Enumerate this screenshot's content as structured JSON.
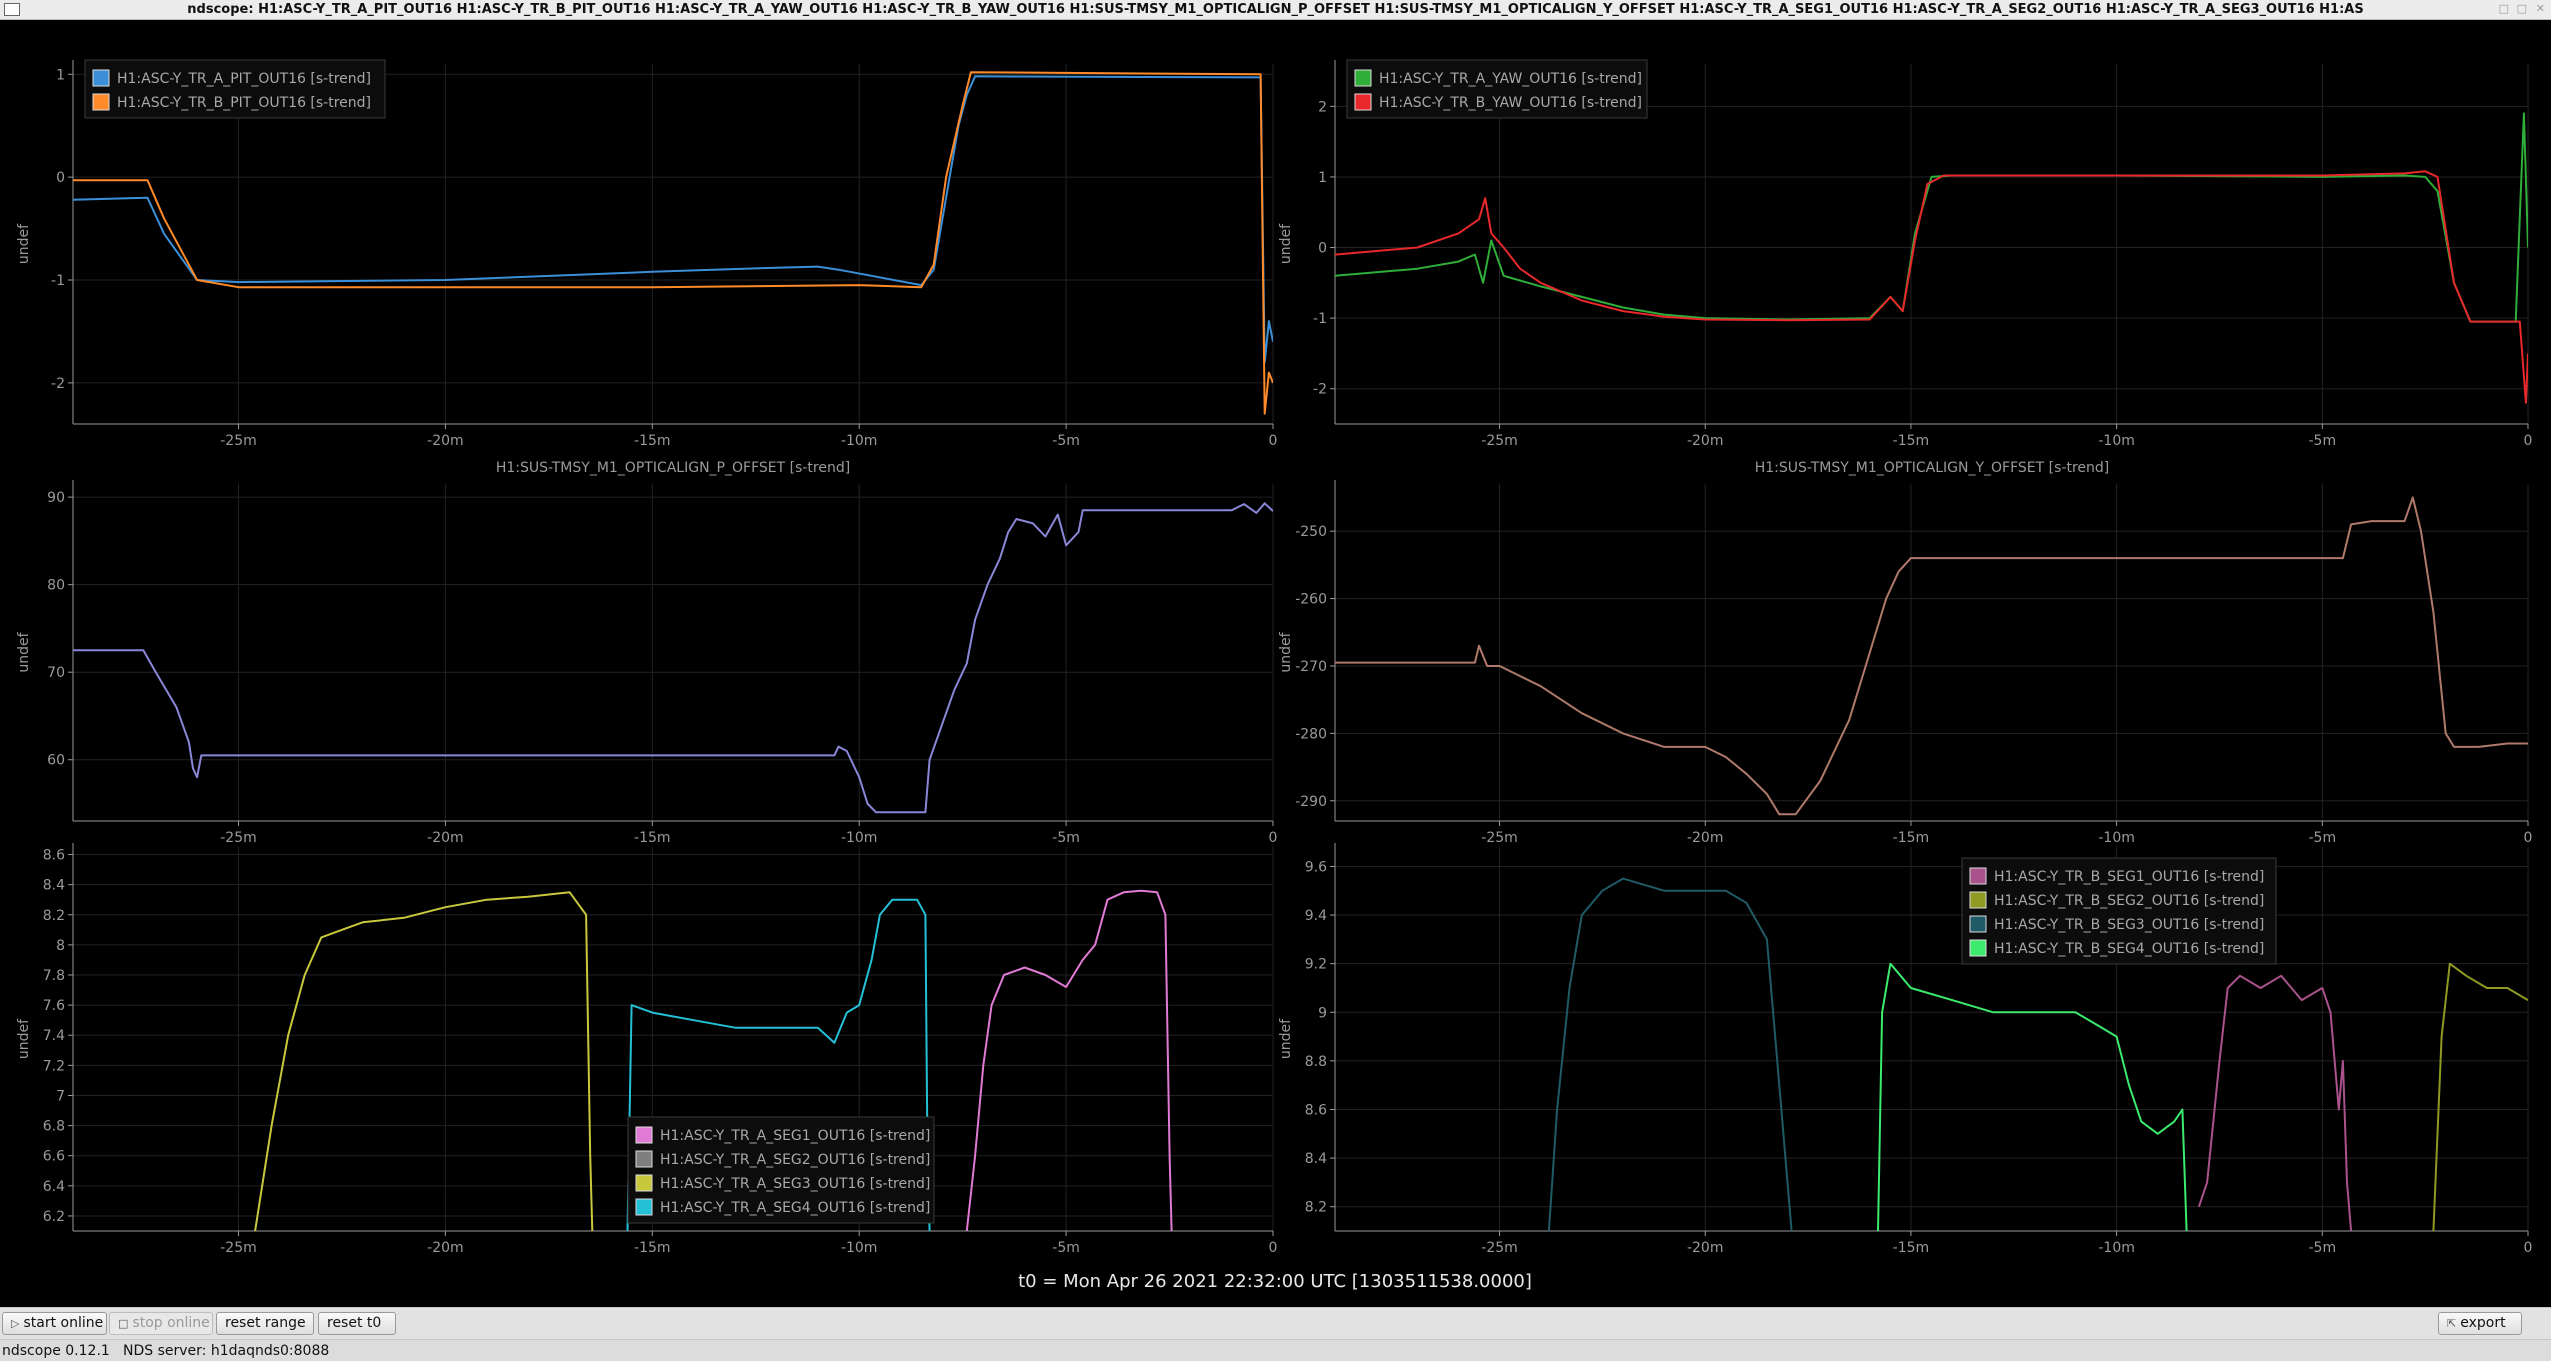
{
  "window": {
    "title": "ndscope: H1:ASC-Y_TR_A_PIT_OUT16 H1:ASC-Y_TR_B_PIT_OUT16 H1:ASC-Y_TR_A_YAW_OUT16 H1:ASC-Y_TR_B_YAW_OUT16 H1:SUS-TMSY_M1_OPTICALIGN_P_OFFSET H1:SUS-TMSY_M1_OPTICALIGN_Y_OFFSET H1:ASC-Y_TR_A_SEG1_OUT16 H1:ASC-Y_TR_A_SEG2_OUT16 H1:ASC-Y_TR_A_SEG3_OUT16 H1:AS"
  },
  "colors": {
    "background": "#000000",
    "axis": "#9a9a9a",
    "grid": "#222222",
    "blue": "#3a8fd8",
    "orange": "#ff8a2a",
    "green": "#2fae3a",
    "red": "#e8282b",
    "purple": "#8a86d8",
    "brown": "#b07a6a",
    "pink": "#e07ad4",
    "gray": "#7f7f7f",
    "yellow": "#c8c83c",
    "cyan": "#24c0d6",
    "mauve": "#a9528c",
    "olive": "#8f9a22",
    "teal": "#1f5a66",
    "lime": "#3cea6e"
  },
  "x_axis": {
    "ticks": [
      -25,
      -20,
      -15,
      -10,
      -5,
      0
    ],
    "tick_labels": [
      "-25m",
      "-20m",
      "-15m",
      "-10m",
      "-5m",
      "0"
    ],
    "xlim": [
      -29,
      0
    ]
  },
  "t0_label": "t0 = Mon Apr 26 2021 22:32:00 UTC [1303511538.0000]",
  "toolbar": {
    "start_online": "start online",
    "stop_online": "stop online",
    "reset_range": "reset range",
    "reset_t0": "reset t0",
    "export": "export"
  },
  "status": {
    "version": "ndscope 0.12.1",
    "server": "NDS server: h1daqnds0:8088"
  },
  "chart_data": [
    {
      "type": "line",
      "ylabel": "undef",
      "ylim": [
        -2.4,
        1.1
      ],
      "yticks": [
        -2,
        -1,
        0,
        1
      ],
      "ytick_labels": [
        "-2",
        "-1",
        "0",
        "1"
      ],
      "grid": true,
      "legend_position": "top-left",
      "series": [
        {
          "name": "H1:ASC-Y_TR_A_PIT_OUT16 [s-trend]",
          "color": "#3a8fd8",
          "x": [
            -29,
            -27.2,
            -26.8,
            -26,
            -25,
            -20,
            -15,
            -12,
            -11,
            -10.5,
            -8.5,
            -8.2,
            -7.6,
            -7.4,
            -7.2,
            -0.3,
            -0.2,
            -0.1,
            0
          ],
          "y": [
            -0.22,
            -0.2,
            -0.55,
            -1.0,
            -1.02,
            -1.0,
            -0.92,
            -0.88,
            -0.87,
            -0.9,
            -1.05,
            -0.9,
            0.5,
            0.8,
            0.98,
            0.97,
            -1.8,
            -1.4,
            -1.6
          ]
        },
        {
          "name": "H1:ASC-Y_TR_B_PIT_OUT16 [s-trend]",
          "color": "#ff8a2a",
          "x": [
            -29,
            -27.2,
            -26.8,
            -26,
            -25,
            -20,
            -15,
            -10,
            -8.5,
            -8.2,
            -7.9,
            -7.5,
            -7.3,
            -0.3,
            -0.2,
            -0.1,
            0
          ],
          "y": [
            -0.03,
            -0.03,
            -0.4,
            -1.0,
            -1.07,
            -1.07,
            -1.07,
            -1.05,
            -1.07,
            -0.85,
            0.0,
            0.7,
            1.02,
            1.0,
            -2.3,
            -1.9,
            -2.0
          ]
        }
      ]
    },
    {
      "type": "line",
      "ylabel": "undef",
      "ylim": [
        -2.5,
        2.6
      ],
      "yticks": [
        -2,
        -1,
        0,
        1,
        2
      ],
      "ytick_labels": [
        "-2",
        "-1",
        "0",
        "1",
        "2"
      ],
      "grid": true,
      "legend_position": "top-left",
      "series": [
        {
          "name": "H1:ASC-Y_TR_A_YAW_OUT16 [s-trend]",
          "color": "#2fae3a",
          "x": [
            -29,
            -27,
            -26,
            -25.6,
            -25.4,
            -25.2,
            -24.9,
            -24,
            -23,
            -22,
            -21,
            -20,
            -18,
            -16,
            -15.5,
            -15.2,
            -14.9,
            -14.5,
            -14,
            -10,
            -5,
            -3,
            -2.5,
            -2.2,
            -1.8,
            -1.4,
            -0.6,
            -0.3,
            -0.1,
            0
          ],
          "y": [
            -0.4,
            -0.3,
            -0.2,
            -0.1,
            -0.5,
            0.1,
            -0.4,
            -0.55,
            -0.7,
            -0.85,
            -0.95,
            -1.0,
            -1.02,
            -1.0,
            -0.7,
            -0.9,
            0.2,
            1.0,
            1.02,
            1.02,
            1.0,
            1.02,
            1.0,
            0.8,
            -0.5,
            -1.05,
            -1.05,
            -1.05,
            1.9,
            0.0
          ]
        },
        {
          "name": "H1:ASC-Y_TR_B_YAW_OUT16 [s-trend]",
          "color": "#e8282b",
          "x": [
            -29,
            -27,
            -26,
            -25.5,
            -25.35,
            -25.2,
            -24.9,
            -24.5,
            -24,
            -23,
            -22,
            -21,
            -20,
            -18,
            -16,
            -15.5,
            -15.2,
            -14.9,
            -14.6,
            -14.2,
            -10,
            -5,
            -3,
            -2.5,
            -2.2,
            -1.8,
            -1.4,
            -0.6,
            -0.2,
            -0.05,
            0
          ],
          "y": [
            -0.1,
            0.0,
            0.2,
            0.4,
            0.7,
            0.2,
            0.0,
            -0.3,
            -0.5,
            -0.75,
            -0.9,
            -0.98,
            -1.02,
            -1.03,
            -1.02,
            -0.7,
            -0.9,
            0.1,
            0.9,
            1.02,
            1.02,
            1.02,
            1.05,
            1.08,
            1.0,
            -0.5,
            -1.05,
            -1.05,
            -1.05,
            -2.2,
            -1.5
          ]
        }
      ]
    },
    {
      "type": "line",
      "title": "H1:SUS-TMSY_M1_OPTICALIGN_P_OFFSET [s-trend]",
      "ylabel": "undef",
      "ylim": [
        53,
        91.5
      ],
      "yticks": [
        60,
        70,
        80,
        90
      ],
      "ytick_labels": [
        "60",
        "70",
        "80",
        "90"
      ],
      "grid": true,
      "series": [
        {
          "name": "H1:SUS-TMSY_M1_OPTICALIGN_P_OFFSET [s-trend]",
          "color": "#8a86d8",
          "x": [
            -29,
            -27.3,
            -27,
            -26.5,
            -26.2,
            -26.1,
            -26,
            -25.9,
            -25,
            -20,
            -15,
            -10.6,
            -10.5,
            -10.3,
            -10,
            -9.8,
            -9.6,
            -9.5,
            -8.4,
            -8.3,
            -8.0,
            -7.7,
            -7.4,
            -7.2,
            -6.9,
            -6.6,
            -6.4,
            -6.2,
            -5.8,
            -5.5,
            -5.2,
            -5.0,
            -4.7,
            -4.6,
            -3,
            -1,
            -0.7,
            -0.4,
            -0.2,
            0
          ],
          "y": [
            72.5,
            72.5,
            70,
            66,
            62,
            59,
            58,
            60.5,
            60.5,
            60.5,
            60.5,
            60.5,
            61.5,
            61,
            58,
            55,
            54,
            54,
            54,
            60,
            64,
            68,
            71,
            76,
            80,
            83,
            86,
            87.5,
            87,
            85.5,
            88,
            84.5,
            86,
            88.5,
            88.5,
            88.5,
            89.2,
            88.2,
            89.3,
            88.4
          ]
        }
      ]
    },
    {
      "type": "line",
      "title": "H1:SUS-TMSY_M1_OPTICALIGN_Y_OFFSET [s-trend]",
      "ylabel": "undef",
      "ylim": [
        -293,
        -243
      ],
      "yticks": [
        -290,
        -280,
        -270,
        -260,
        -250
      ],
      "ytick_labels": [
        "-290",
        "-280",
        "-270",
        "-260",
        "-250"
      ],
      "grid": true,
      "series": [
        {
          "name": "H1:SUS-TMSY_M1_OPTICALIGN_Y_OFFSET [s-trend]",
          "color": "#b07a6a",
          "x": [
            -29,
            -25.6,
            -25.5,
            -25.3,
            -25,
            -24,
            -23,
            -22,
            -21,
            -20,
            -19.5,
            -19,
            -18.5,
            -18.2,
            -17.8,
            -17.2,
            -16.5,
            -16,
            -15.6,
            -15.3,
            -15,
            -10,
            -5,
            -4.5,
            -4.3,
            -3.8,
            -3,
            -2.8,
            -2.6,
            -2.3,
            -2,
            -1.8,
            -1.6,
            -1.2,
            -0.5,
            0
          ],
          "y": [
            -269.5,
            -269.5,
            -267,
            -270,
            -270,
            -273,
            -277,
            -280,
            -282,
            -282,
            -283.5,
            -286,
            -289,
            -292,
            -292,
            -287,
            -278,
            -268,
            -260,
            -256,
            -254,
            -254,
            -254,
            -254,
            -249,
            -248.5,
            -248.5,
            -245,
            -250,
            -262,
            -280,
            -282,
            -282,
            -282,
            -281.5,
            -281.5
          ]
        }
      ]
    },
    {
      "type": "line",
      "ylabel": "undef",
      "ylim": [
        6.1,
        8.65
      ],
      "yticks": [
        6.2,
        6.4,
        6.6,
        6.8,
        7.0,
        7.2,
        7.4,
        7.6,
        7.8,
        8.0,
        8.2,
        8.4,
        8.6
      ],
      "ytick_labels": [
        "6.2",
        "6.4",
        "6.6",
        "6.8",
        "7",
        "7.2",
        "7.4",
        "7.6",
        "7.8",
        "8",
        "8.2",
        "8.4",
        "8.6"
      ],
      "grid": true,
      "legend_position": "bottom-center",
      "series": [
        {
          "name": "H1:ASC-Y_TR_A_SEG1_OUT16 [s-trend]",
          "color": "#e07ad4",
          "x": [
            -7.4,
            -7.2,
            -7.0,
            -6.8,
            -6.5,
            -6.0,
            -5.5,
            -5.0,
            -4.6,
            -4.3,
            -4.0,
            -3.6,
            -3.2,
            -2.8,
            -2.6,
            -2.5,
            -2.45
          ],
          "y": [
            6.1,
            6.6,
            7.2,
            7.6,
            7.8,
            7.85,
            7.8,
            7.72,
            7.9,
            8.0,
            8.3,
            8.35,
            8.36,
            8.35,
            8.2,
            6.6,
            6.1
          ]
        },
        {
          "name": "H1:ASC-Y_TR_A_SEG2_OUT16 [s-trend]",
          "color": "#7f7f7f",
          "x": [],
          "y": []
        },
        {
          "name": "H1:ASC-Y_TR_A_SEG3_OUT16 [s-trend]",
          "color": "#c8c83c",
          "x": [
            -24.6,
            -24.2,
            -23.8,
            -23.4,
            -23.0,
            -22.5,
            -22.0,
            -21.0,
            -20.0,
            -19.0,
            -18.0,
            -17.0,
            -16.6,
            -16.5,
            -16.45
          ],
          "y": [
            6.1,
            6.8,
            7.4,
            7.8,
            8.05,
            8.1,
            8.15,
            8.18,
            8.25,
            8.3,
            8.32,
            8.35,
            8.2,
            6.6,
            6.1
          ]
        },
        {
          "name": "H1:ASC-Y_TR_A_SEG4_OUT16 [s-trend]",
          "color": "#24c0d6",
          "x": [
            -15.6,
            -15.5,
            -15.0,
            -14.0,
            -13.0,
            -12.0,
            -11.0,
            -10.6,
            -10.3,
            -10.0,
            -9.7,
            -9.5,
            -9.2,
            -8.9,
            -8.6,
            -8.4,
            -8.35,
            -8.3
          ],
          "y": [
            6.1,
            7.6,
            7.55,
            7.5,
            7.45,
            7.45,
            7.45,
            7.35,
            7.55,
            7.6,
            7.9,
            8.2,
            8.3,
            8.3,
            8.3,
            8.2,
            6.6,
            6.1
          ]
        }
      ]
    },
    {
      "type": "line",
      "ylabel": "undef",
      "ylim": [
        8.1,
        9.68
      ],
      "yticks": [
        8.2,
        8.4,
        8.6,
        8.8,
        9.0,
        9.2,
        9.4,
        9.6
      ],
      "ytick_labels": [
        "8.2",
        "8.4",
        "8.6",
        "8.8",
        "9",
        "9.2",
        "9.4",
        "9.6"
      ],
      "grid": true,
      "legend_position": "top-right",
      "series": [
        {
          "name": "H1:ASC-Y_TR_B_SEG1_OUT16 [s-trend]",
          "color": "#a9528c",
          "x": [
            -8.0,
            -7.8,
            -7.5,
            -7.3,
            -7.0,
            -6.5,
            -6.0,
            -5.5,
            -5.0,
            -4.8,
            -4.6,
            -4.5,
            -4.4,
            -4.3
          ],
          "y": [
            8.2,
            8.3,
            8.8,
            9.1,
            9.15,
            9.1,
            9.15,
            9.05,
            9.1,
            9.0,
            8.6,
            8.8,
            8.3,
            8.1
          ]
        },
        {
          "name": "H1:ASC-Y_TR_B_SEG2_OUT16 [s-trend]",
          "color": "#8f9a22",
          "x": [
            -2.3,
            -2.1,
            -1.9,
            -1.5,
            -1.0,
            -0.5,
            0
          ],
          "y": [
            8.1,
            8.9,
            9.2,
            9.15,
            9.1,
            9.1,
            9.05
          ]
        },
        {
          "name": "H1:ASC-Y_TR_B_SEG3_OUT16 [s-trend]",
          "color": "#1f5a66",
          "x": [
            -23.8,
            -23.6,
            -23.3,
            -23.0,
            -22.5,
            -22.0,
            -21.0,
            -20.0,
            -19.5,
            -19.0,
            -18.5,
            -18.2,
            -18.0,
            -17.9
          ],
          "y": [
            8.1,
            8.6,
            9.1,
            9.4,
            9.5,
            9.55,
            9.5,
            9.5,
            9.5,
            9.45,
            9.3,
            8.7,
            8.3,
            8.1
          ]
        },
        {
          "name": "H1:ASC-Y_TR_B_SEG4_OUT16 [s-trend]",
          "color": "#3cea6e",
          "x": [
            -15.8,
            -15.7,
            -15.5,
            -15.0,
            -14.0,
            -13.0,
            -12.0,
            -11.0,
            -10.5,
            -10.0,
            -9.7,
            -9.4,
            -9.0,
            -8.6,
            -8.4,
            -8.3
          ],
          "y": [
            8.1,
            9.0,
            9.2,
            9.1,
            9.05,
            9.0,
            9.0,
            9.0,
            8.95,
            8.9,
            8.7,
            8.55,
            8.5,
            8.55,
            8.6,
            8.1
          ]
        }
      ]
    }
  ]
}
